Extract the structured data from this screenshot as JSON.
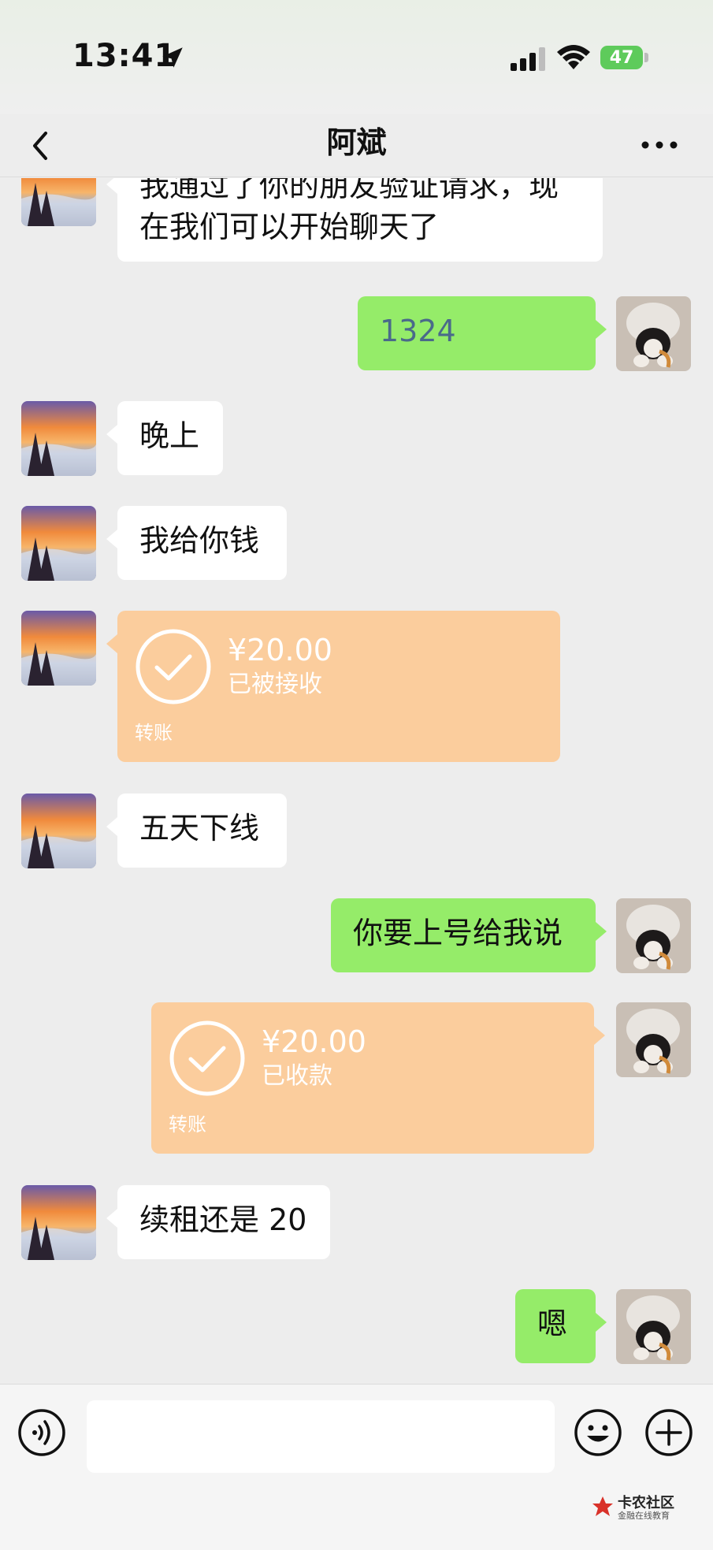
{
  "status_bar": {
    "time": "13:41",
    "battery": "47"
  },
  "nav": {
    "title": "阿斌"
  },
  "messages": [
    {
      "side": "left",
      "type": "text",
      "text_line1": "我通过了你的朋友验证请求，现",
      "text_line2": "在我们可以开始聊天了"
    },
    {
      "side": "right",
      "type": "text",
      "text": "1324"
    },
    {
      "side": "left",
      "type": "text",
      "text": "晚上"
    },
    {
      "side": "left",
      "type": "text",
      "text": "我给你钱"
    },
    {
      "side": "left",
      "type": "transfer",
      "amount": "¥20.00",
      "status": "已被接收",
      "label": "转账"
    },
    {
      "side": "left",
      "type": "text",
      "text": "五天下线"
    },
    {
      "side": "right",
      "type": "text",
      "text": "你要上号给我说"
    },
    {
      "side": "right",
      "type": "transfer",
      "amount": "¥20.00",
      "status": "已收款",
      "label": "转账"
    },
    {
      "side": "left",
      "type": "text",
      "text": "续租还是 20"
    },
    {
      "side": "right",
      "type": "text",
      "text": "嗯"
    }
  ],
  "watermark": {
    "title": "卡农社区",
    "subtitle": "金融在线教育"
  },
  "colors": {
    "background": "#ededed",
    "bubble_left": "#ffffff",
    "bubble_right": "#95ec69",
    "transfer": "#fbcd9d",
    "battery": "#5ecb5b"
  }
}
